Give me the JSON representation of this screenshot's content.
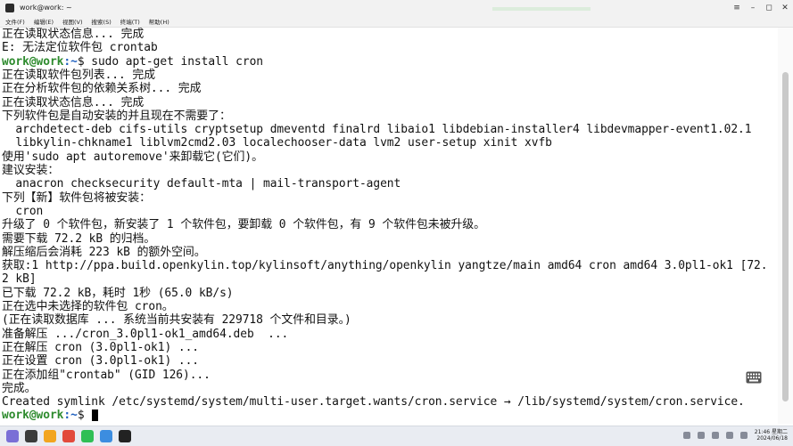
{
  "window": {
    "title": "work@work: ~"
  },
  "menu": {
    "items": [
      "文件(F)",
      "编辑(E)",
      "视图(V)",
      "搜索(S)",
      "终端(T)",
      "帮助(H)"
    ]
  },
  "terminal": {
    "lines": [
      {
        "text": "正在读取状态信息... 完成"
      },
      {
        "text": "E: 无法定位软件包 crontab"
      },
      {
        "prompt_user": "work@work",
        "prompt_path": ":~",
        "prompt_sym": "$ ",
        "text": "sudo apt-get install cron"
      },
      {
        "text": "正在读取软件包列表... 完成"
      },
      {
        "text": "正在分析软件包的依赖关系树... 完成"
      },
      {
        "text": "正在读取状态信息... 完成"
      },
      {
        "text": "下列软件包是自动安装的并且现在不需要了："
      },
      {
        "text": "  archdetect-deb cifs-utils cryptsetup dmeventd finalrd libaio1 libdebian-installer4 libdevmapper-event1.02.1"
      },
      {
        "text": "  libkylin-chkname1 liblvm2cmd2.03 localechooser-data lvm2 user-setup xinit xvfb"
      },
      {
        "text": "使用'sudo apt autoremove'来卸载它(它们)。"
      },
      {
        "text": "建议安装："
      },
      {
        "text": "  anacron checksecurity default-mta | mail-transport-agent"
      },
      {
        "text": "下列【新】软件包将被安装："
      },
      {
        "text": "  cron"
      },
      {
        "text": "升级了 0 个软件包，新安装了 1 个软件包，要卸载 0 个软件包，有 9 个软件包未被升级。"
      },
      {
        "text": "需要下载 72.2 kB 的归档。"
      },
      {
        "text": "解压缩后会消耗 223 kB 的额外空间。"
      },
      {
        "text": "获取:1 http://ppa.build.openkylin.top/kylinsoft/anything/openkylin yangtze/main amd64 cron amd64 3.0pl1-ok1 [72."
      },
      {
        "text": "2 kB]"
      },
      {
        "text": "已下载 72.2 kB，耗时 1秒 (65.0 kB/s)"
      },
      {
        "text": "正在选中未选择的软件包 cron。"
      },
      {
        "text": "(正在读取数据库 ... 系统当前共安装有 229718 个文件和目录。)"
      },
      {
        "text": "准备解压 .../cron_3.0pl1-ok1_amd64.deb  ..."
      },
      {
        "text": "正在解压 cron (3.0pl1-ok1) ..."
      },
      {
        "text": "正在设置 cron (3.0pl1-ok1) ..."
      },
      {
        "text": "正在添加组\"crontab\" (GID 126)..."
      },
      {
        "text": "完成。"
      },
      {
        "text": "Created symlink /etc/systemd/system/multi-user.target.wants/cron.service → /lib/systemd/system/cron.service."
      },
      {
        "prompt_user": "work@work",
        "prompt_path": ":~",
        "prompt_sym": "$ ",
        "text": "",
        "cursor": true
      }
    ]
  },
  "taskbar": {
    "apps": [
      {
        "icon": "start-menu-icon",
        "color": "#7a6fd6"
      },
      {
        "icon": "file-manager-icon",
        "color": "#3b3b3b"
      },
      {
        "icon": "browser-icon",
        "color": "#f2a51f"
      },
      {
        "icon": "app-store-icon",
        "color": "#e24a3b"
      },
      {
        "icon": "wechat-icon",
        "color": "#2fbf55"
      },
      {
        "icon": "settings-icon",
        "color": "#3c8de0"
      },
      {
        "icon": "terminal-icon",
        "color": "#222222"
      }
    ],
    "clock_time": "21:46 星期二",
    "clock_date": "2024/06/18"
  },
  "colors": {
    "prompt_user": "#2e8b2e",
    "prompt_path": "#1e5fbf"
  }
}
